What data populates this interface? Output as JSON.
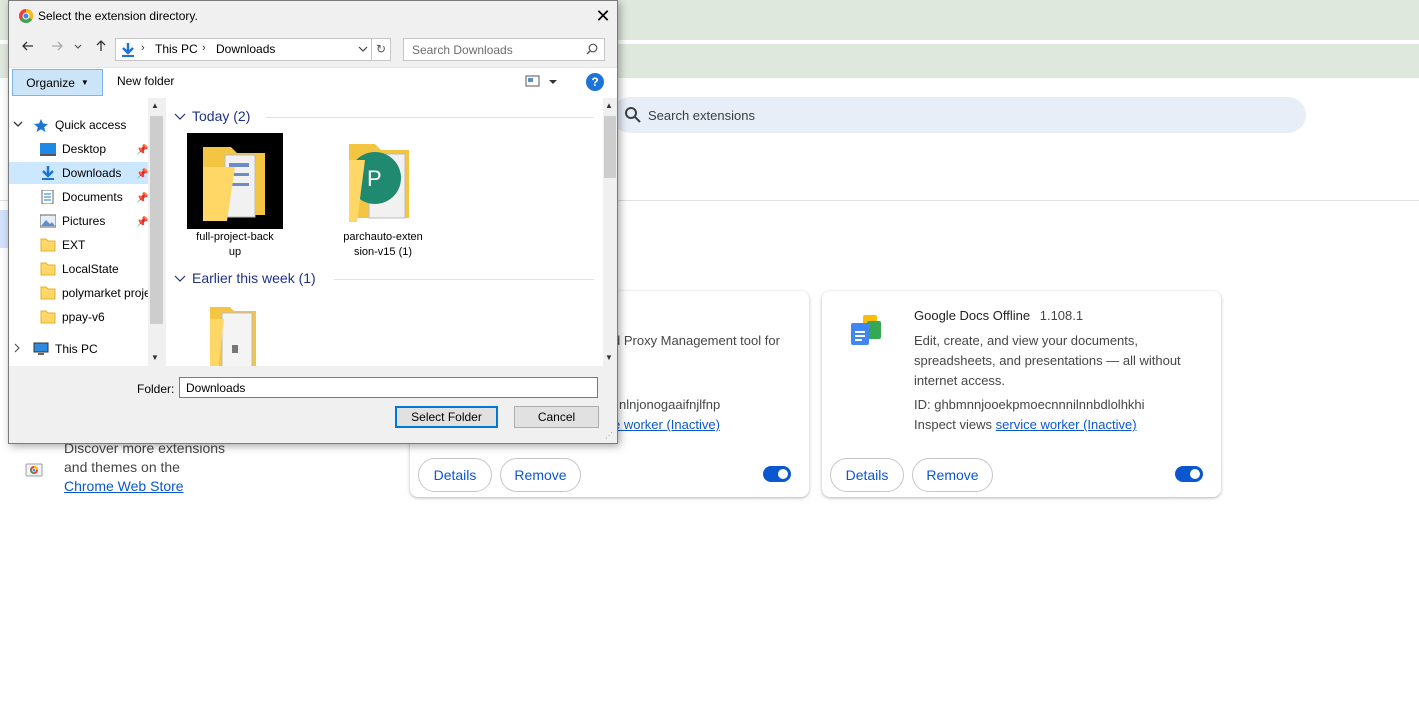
{
  "background": {
    "search": {
      "placeholder": "Search extensions"
    },
    "cards": [
      {
        "description_fragment": "d Proxy Management tool for",
        "id_fragment": "nlnjonogaaifnjlfnp",
        "inspect_link_fragment": "e worker (Inactive)",
        "details_label": "Details",
        "remove_label": "Remove",
        "enabled": true
      },
      {
        "name": "Google Docs Offline",
        "version": "1.108.1",
        "description_lines": [
          "Edit, create, and view your documents,",
          "spreadsheets, and presentations — all without",
          "internet access."
        ],
        "id_text": "ID: ghbmnnjooekpmoecnnnilnnbdlolhkhi",
        "inspect_prefix": "Inspect views",
        "inspect_link": "service worker (Inactive)",
        "details_label": "Details",
        "remove_label": "Remove",
        "enabled": true
      }
    ],
    "webstore": {
      "line1": "Discover more extensions",
      "line2": "and themes on the",
      "link": "Chrome Web Store"
    },
    "colors": {
      "accent": "#0b57d0",
      "band": "#dfe8dc"
    }
  },
  "dialog": {
    "title": "Select the extension directory.",
    "breadcrumb": [
      "This PC",
      "Downloads"
    ],
    "search_placeholder": "Search Downloads",
    "organize_label": "Organize",
    "new_folder_label": "New folder",
    "help_label": "?",
    "nav": {
      "quick_access": "Quick access",
      "items": [
        "Desktop",
        "Downloads",
        "Documents",
        "Pictures",
        "EXT",
        "LocalState",
        "polymarket project",
        "ppay-v6"
      ],
      "this_pc": "This PC"
    },
    "groups": [
      {
        "label": "Today (2)",
        "files": [
          {
            "line1": "full-project-back",
            "line2": "up"
          },
          {
            "line1": "parchauto-exten",
            "line2": "sion-v15 (1)"
          }
        ]
      },
      {
        "label": "Earlier this week (1)",
        "files": []
      }
    ],
    "folder_label": "Folder:",
    "folder_value": "Downloads",
    "select_label": "Select Folder",
    "cancel_label": "Cancel"
  }
}
